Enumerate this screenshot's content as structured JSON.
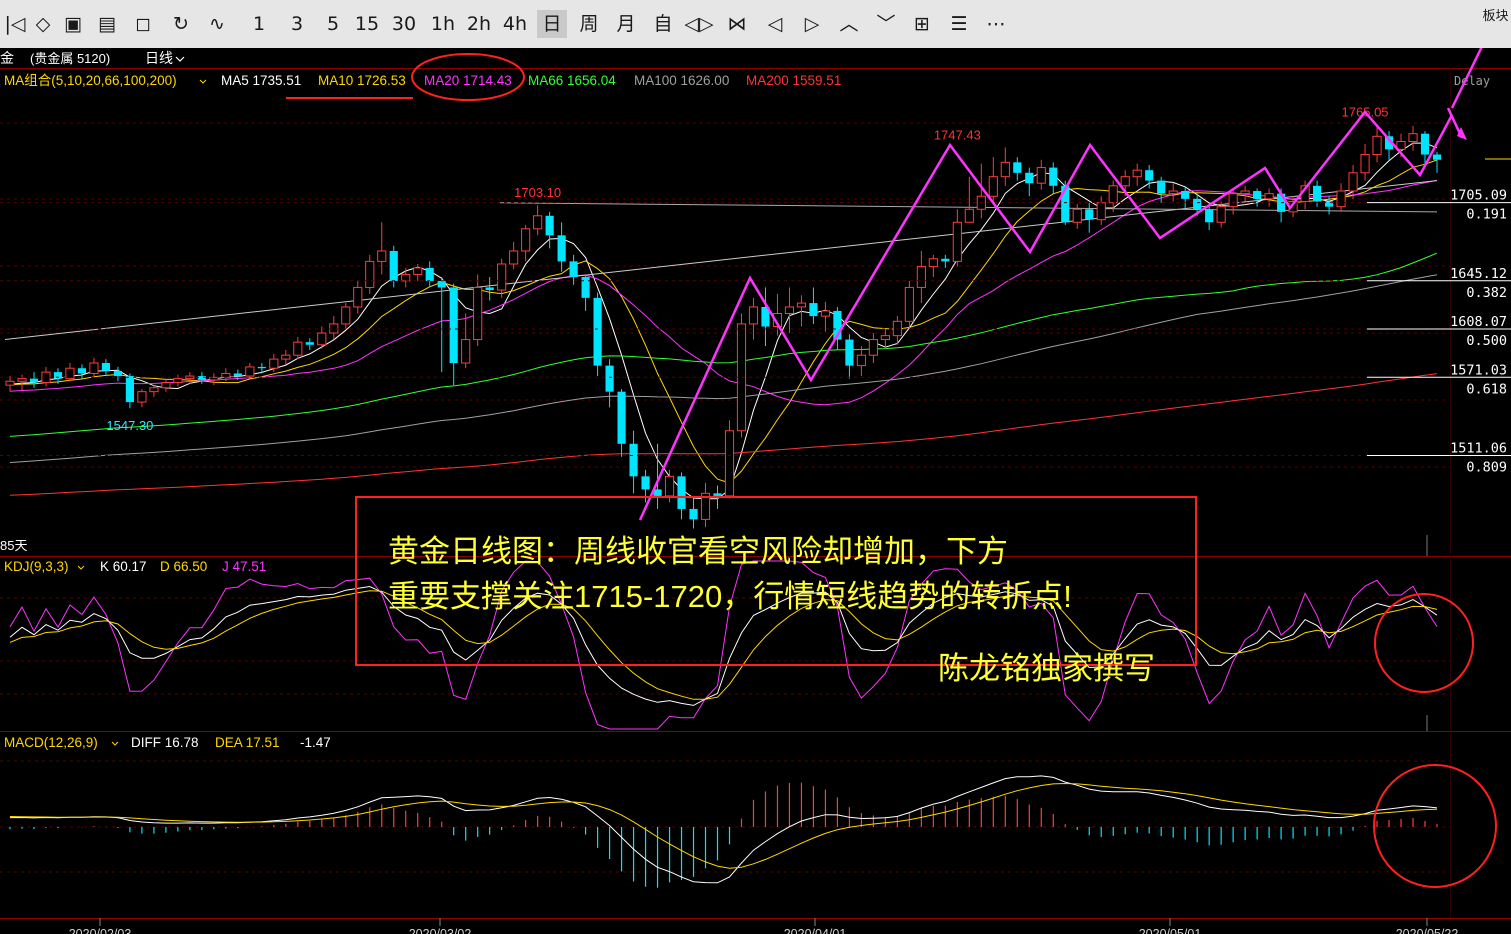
{
  "toolbar": {
    "items": [
      {
        "label": "|◁",
        "icon": "cursor-left-icon"
      },
      {
        "label": "◇",
        "icon": "diamond-icon"
      },
      {
        "label": "▣",
        "icon": "box-icon"
      },
      {
        "label": "▤",
        "icon": "panel-icon"
      },
      {
        "label": "◻",
        "icon": "save-icon"
      },
      {
        "label": "↻",
        "icon": "refresh-icon"
      },
      {
        "label": "∿",
        "icon": "draw-icon"
      },
      {
        "label": "1"
      },
      {
        "label": "3"
      },
      {
        "label": "5"
      },
      {
        "label": "15"
      },
      {
        "label": "30"
      },
      {
        "label": "1h"
      },
      {
        "label": "2h"
      },
      {
        "label": "4h"
      },
      {
        "label": "日",
        "selected": true
      },
      {
        "label": "周"
      },
      {
        "label": "月"
      },
      {
        "label": "自"
      },
      {
        "label": "◁▷",
        "icon": "zoom-icon"
      },
      {
        "label": "⋈",
        "icon": "bowtie-icon"
      },
      {
        "label": "◁",
        "icon": "arrow-left-icon"
      },
      {
        "label": "▷",
        "icon": "arrow-right-icon"
      },
      {
        "label": "︿",
        "icon": "chevron-up-icon"
      },
      {
        "label": "﹀",
        "icon": "chevron-down-icon"
      },
      {
        "label": "⊞",
        "icon": "grid-icon"
      },
      {
        "label": "☰",
        "icon": "list-icon"
      },
      {
        "label": "⋯",
        "icon": "more-icon"
      }
    ],
    "right_label": "板块"
  },
  "header": {
    "symbol": "金",
    "market": "(贵金属 5120)",
    "period": "日线",
    "delay": "Delay"
  },
  "ma_legend": [
    {
      "label": "MA组合(5,10,20,66,100,200)",
      "color": "#ffd700"
    },
    {
      "label": "MA5 1735.51",
      "color": "#ffffff"
    },
    {
      "label": "MA10 1726.53",
      "color": "#ffd700"
    },
    {
      "label": "MA20 1714.43",
      "color": "#ff33ff"
    },
    {
      "label": "MA66 1656.04",
      "color": "#33ff33"
    },
    {
      "label": "MA100 1626.00",
      "color": "#a0a0a0"
    },
    {
      "label": "MA200 1559.51",
      "color": "#ff3333"
    }
  ],
  "kdj_legend": [
    {
      "label": "KDJ(9,3,3)",
      "color": "#ffd700"
    },
    {
      "label": "K 60.17",
      "color": "#ffffff"
    },
    {
      "label": "D 66.50",
      "color": "#ffd700"
    },
    {
      "label": "J 47.51",
      "color": "#ff33ff"
    }
  ],
  "macd_legend": [
    {
      "label": "MACD(12,26,9)",
      "color": "#ffd700"
    },
    {
      "label": "DIFF 16.78",
      "color": "#ffffff"
    },
    {
      "label": "DEA 17.51",
      "color": "#ffd700"
    },
    {
      "label": "-1.47",
      "color": "#ffffff"
    }
  ],
  "annotations": {
    "line1": "黄金日线图：周线收官看空风险却增加，下方",
    "line2": "重要支撑关注1715-1720，行情短线趋势的转折点!",
    "author": "陈龙铭独家撰写",
    "days_label": "85天"
  },
  "chart_data": {
    "type": "candlestick",
    "symbol": "金",
    "period": "日线",
    "x_ticks": [
      "2020/02/03",
      "2020/03/02",
      "2020/04/01",
      "2020/05/01",
      "2020/05/22"
    ],
    "ylim": [
      1450,
      1790
    ],
    "peak_labels": [
      {
        "label": "1547.30",
        "index": 10,
        "value": 1547.3,
        "kind": "low",
        "color": "#33e6ff"
      },
      {
        "label": "1703.10",
        "index": 44,
        "value": 1703.1,
        "kind": "high",
        "color": "#ff3333"
      },
      {
        "label": "1747.43",
        "index": 79,
        "value": 1747.43,
        "kind": "high",
        "color": "#ff3333"
      },
      {
        "label": "1765.05",
        "index": 113,
        "value": 1765.05,
        "kind": "high",
        "color": "#ff3333"
      }
    ],
    "fib_levels": [
      {
        "price": "1705.09",
        "ratio": "0.191",
        "value": 1705.09
      },
      {
        "price": "1645.12",
        "ratio": "0.382",
        "value": 1645.12
      },
      {
        "price": "1608.07",
        "ratio": "0.500",
        "value": 1608.07
      },
      {
        "price": "1571.03",
        "ratio": "0.618",
        "value": 1571.03
      },
      {
        "price": "1511.06",
        "ratio": "0.809",
        "value": 1511.06
      }
    ],
    "candles": [
      [
        1565,
        1568,
        1560,
        1572
      ],
      [
        1568,
        1570,
        1561,
        1573
      ],
      [
        1570,
        1567,
        1563,
        1575
      ],
      [
        1567,
        1575,
        1564,
        1579
      ],
      [
        1575,
        1570,
        1566,
        1578
      ],
      [
        1570,
        1578,
        1568,
        1582
      ],
      [
        1578,
        1574,
        1570,
        1581
      ],
      [
        1574,
        1582,
        1571,
        1586
      ],
      [
        1582,
        1576,
        1573,
        1585
      ],
      [
        1576,
        1572,
        1568,
        1579
      ],
      [
        1572,
        1552,
        1547.3,
        1574
      ],
      [
        1552,
        1560,
        1548,
        1562
      ],
      [
        1560,
        1563,
        1556,
        1565
      ],
      [
        1563,
        1567,
        1560,
        1570
      ],
      [
        1567,
        1570,
        1564,
        1573
      ],
      [
        1570,
        1572,
        1566,
        1575
      ],
      [
        1572,
        1569,
        1566,
        1575
      ],
      [
        1569,
        1571,
        1565,
        1574
      ],
      [
        1571,
        1574,
        1568,
        1578
      ],
      [
        1574,
        1572,
        1569,
        1577
      ],
      [
        1572,
        1579,
        1570,
        1582
      ],
      [
        1579,
        1578,
        1574,
        1582
      ],
      [
        1578,
        1585,
        1575,
        1589
      ],
      [
        1585,
        1588,
        1581,
        1592
      ],
      [
        1588,
        1598,
        1585,
        1602
      ],
      [
        1598,
        1596,
        1592,
        1601
      ],
      [
        1596,
        1605,
        1593,
        1610
      ],
      [
        1605,
        1612,
        1600,
        1618
      ],
      [
        1612,
        1625,
        1608,
        1628
      ],
      [
        1625,
        1640,
        1620,
        1645
      ],
      [
        1640,
        1660,
        1635,
        1665
      ],
      [
        1660,
        1668,
        1650,
        1690
      ],
      [
        1668,
        1645,
        1640,
        1672
      ],
      [
        1645,
        1650,
        1640,
        1655
      ],
      [
        1650,
        1655,
        1645,
        1658
      ],
      [
        1655,
        1645,
        1640,
        1660
      ],
      [
        1645,
        1640,
        1575,
        1648
      ],
      [
        1640,
        1582,
        1565,
        1643
      ],
      [
        1582,
        1600,
        1578,
        1620
      ],
      [
        1600,
        1640,
        1595,
        1650
      ],
      [
        1640,
        1638,
        1630,
        1648
      ],
      [
        1638,
        1658,
        1632,
        1662
      ],
      [
        1658,
        1668,
        1654,
        1675
      ],
      [
        1668,
        1685,
        1660,
        1688
      ],
      [
        1685,
        1695,
        1680,
        1703.1
      ],
      [
        1695,
        1680,
        1670,
        1698
      ],
      [
        1680,
        1660,
        1652,
        1690
      ],
      [
        1660,
        1648,
        1642,
        1665
      ],
      [
        1648,
        1632,
        1622,
        1650
      ],
      [
        1632,
        1580,
        1572,
        1636
      ],
      [
        1580,
        1560,
        1548,
        1585
      ],
      [
        1560,
        1520,
        1510,
        1562
      ],
      [
        1520,
        1495,
        1482,
        1530
      ],
      [
        1495,
        1485,
        1475,
        1500
      ],
      [
        1485,
        1480,
        1470,
        1520
      ],
      [
        1480,
        1495,
        1475,
        1500
      ],
      [
        1495,
        1470,
        1462,
        1498
      ],
      [
        1470,
        1462,
        1455,
        1478
      ],
      [
        1462,
        1482,
        1456,
        1490
      ],
      [
        1482,
        1480,
        1470,
        1488
      ],
      [
        1480,
        1530,
        1478,
        1538
      ],
      [
        1530,
        1612,
        1525,
        1620
      ],
      [
        1612,
        1625,
        1600,
        1632
      ],
      [
        1625,
        1610,
        1595,
        1640
      ],
      [
        1610,
        1620,
        1603,
        1635
      ],
      [
        1620,
        1625,
        1605,
        1640
      ],
      [
        1625,
        1628,
        1610,
        1634
      ],
      [
        1628,
        1618,
        1612,
        1640
      ],
      [
        1618,
        1622,
        1606,
        1629
      ],
      [
        1622,
        1600,
        1592,
        1625
      ],
      [
        1600,
        1580,
        1570,
        1604
      ],
      [
        1580,
        1588,
        1572,
        1595
      ],
      [
        1588,
        1600,
        1582,
        1605
      ],
      [
        1600,
        1603,
        1593,
        1608
      ],
      [
        1603,
        1614,
        1596,
        1618
      ],
      [
        1614,
        1640,
        1608,
        1645
      ],
      [
        1640,
        1656,
        1628,
        1668
      ],
      [
        1656,
        1662,
        1648,
        1665
      ],
      [
        1662,
        1660,
        1655,
        1665
      ],
      [
        1660,
        1690,
        1656,
        1700
      ],
      [
        1690,
        1700,
        1690,
        1725
      ],
      [
        1700,
        1710,
        1693,
        1735
      ],
      [
        1710,
        1725,
        1705,
        1740
      ],
      [
        1725,
        1736,
        1718,
        1747.43
      ],
      [
        1736,
        1728,
        1722,
        1740
      ],
      [
        1728,
        1720,
        1710,
        1732
      ],
      [
        1720,
        1732,
        1715,
        1738
      ],
      [
        1732,
        1718,
        1712,
        1736
      ],
      [
        1718,
        1690,
        1688,
        1722
      ],
      [
        1690,
        1700,
        1685,
        1704
      ],
      [
        1700,
        1692,
        1682,
        1705
      ],
      [
        1692,
        1705,
        1688,
        1710
      ],
      [
        1705,
        1718,
        1698,
        1722
      ],
      [
        1718,
        1725,
        1710,
        1730
      ],
      [
        1725,
        1730,
        1718,
        1735
      ],
      [
        1730,
        1722,
        1716,
        1734
      ],
      [
        1722,
        1712,
        1705,
        1725
      ],
      [
        1712,
        1714,
        1706,
        1720
      ],
      [
        1714,
        1708,
        1700,
        1718
      ],
      [
        1708,
        1700,
        1695,
        1712
      ],
      [
        1700,
        1690,
        1684,
        1703
      ],
      [
        1690,
        1702,
        1686,
        1706
      ],
      [
        1702,
        1712,
        1696,
        1716
      ],
      [
        1712,
        1714,
        1706,
        1718
      ],
      [
        1714,
        1708,
        1702,
        1716
      ],
      [
        1708,
        1712,
        1702,
        1716
      ],
      [
        1712,
        1698,
        1690,
        1716
      ],
      [
        1698,
        1706,
        1694,
        1710
      ],
      [
        1706,
        1718,
        1700,
        1722
      ],
      [
        1718,
        1706,
        1702,
        1722
      ],
      [
        1706,
        1702,
        1696,
        1710
      ],
      [
        1702,
        1714,
        1698,
        1720
      ],
      [
        1714,
        1728,
        1708,
        1734
      ],
      [
        1728,
        1742,
        1722,
        1750
      ],
      [
        1742,
        1756,
        1736,
        1765.05
      ],
      [
        1756,
        1746,
        1738,
        1760
      ],
      [
        1746,
        1752,
        1740,
        1758
      ],
      [
        1752,
        1758,
        1745,
        1764
      ],
      [
        1758,
        1742,
        1732,
        1760
      ],
      [
        1742,
        1738,
        1728,
        1744
      ]
    ]
  }
}
